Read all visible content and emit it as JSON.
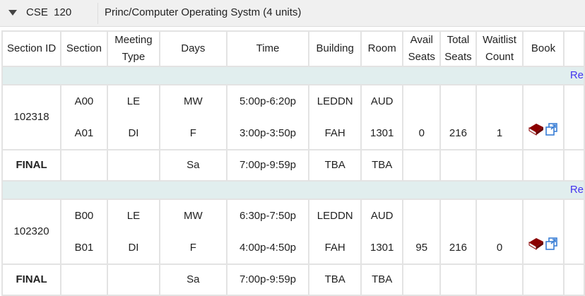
{
  "course": {
    "code": "CSE  120",
    "title": "Princ/Computer Operating Systm (4 units)"
  },
  "headers": [
    "Section ID",
    "Section",
    "Meeting Type",
    "Days",
    "Time",
    "Building",
    "Room",
    "Avail Seats",
    "Total Seats",
    "Waitlist Count",
    "Book"
  ],
  "link_text": "Re",
  "groups": [
    {
      "id": "102318",
      "rows": [
        {
          "section": "A00",
          "type": "LE",
          "days": "MW",
          "time": "5:00p-6:20p",
          "building": "LEDDN",
          "room": "AUD"
        },
        {
          "section": "A01",
          "type": "DI",
          "days": "F",
          "time": "3:00p-3:50p",
          "building": "FAH",
          "room": "1301"
        }
      ],
      "avail": "0",
      "total": "216",
      "waitlist": "1",
      "final": {
        "label": "FINAL",
        "days": "Sa",
        "time": "7:00p-9:59p",
        "building": "TBA",
        "room": "TBA"
      }
    },
    {
      "id": "102320",
      "rows": [
        {
          "section": "B00",
          "type": "LE",
          "days": "MW",
          "time": "6:30p-7:50p",
          "building": "LEDDN",
          "room": "AUD"
        },
        {
          "section": "B01",
          "type": "DI",
          "days": "F",
          "time": "4:00p-4:50p",
          "building": "FAH",
          "room": "1301"
        }
      ],
      "avail": "95",
      "total": "216",
      "waitlist": "0",
      "final": {
        "label": "FINAL",
        "days": "Sa",
        "time": "7:00p-9:59p",
        "building": "TBA",
        "room": "TBA"
      }
    }
  ]
}
